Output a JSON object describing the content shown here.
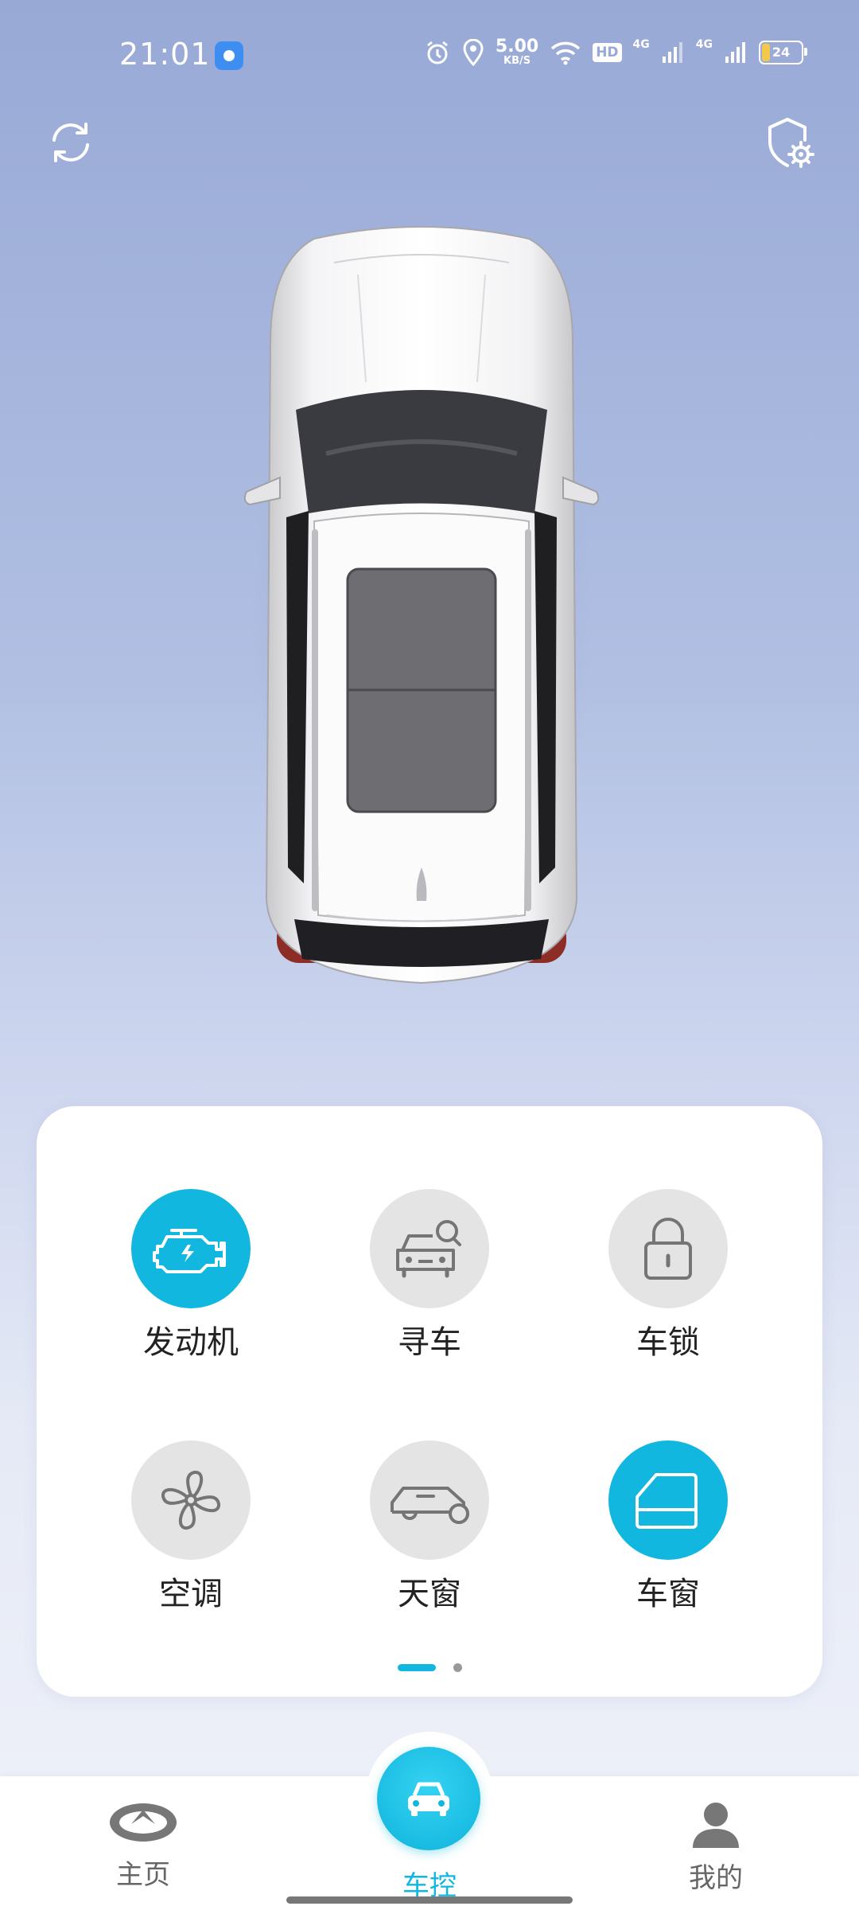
{
  "status_bar": {
    "time": "21:01",
    "net_speed_value": "5.00",
    "net_speed_unit": "KB/S",
    "hd_label": "HD",
    "signal1_label": "4G",
    "signal2_label": "4G",
    "battery_level": "24"
  },
  "controls": [
    {
      "label": "发动机",
      "icon": "engine-icon",
      "active": true
    },
    {
      "label": "寻车",
      "icon": "find-car-icon",
      "active": false
    },
    {
      "label": "车锁",
      "icon": "lock-icon",
      "active": false
    },
    {
      "label": "空调",
      "icon": "fan-icon",
      "active": false
    },
    {
      "label": "天窗",
      "icon": "sunroof-icon",
      "active": false
    },
    {
      "label": "车窗",
      "icon": "window-icon",
      "active": true
    }
  ],
  "pager": {
    "current": 1,
    "total": 2
  },
  "bottom_nav": {
    "home_label": "主页",
    "control_label": "车控",
    "mine_label": "我的"
  },
  "colors": {
    "accent": "#12b7df",
    "inactive": "#e4e4e4"
  }
}
